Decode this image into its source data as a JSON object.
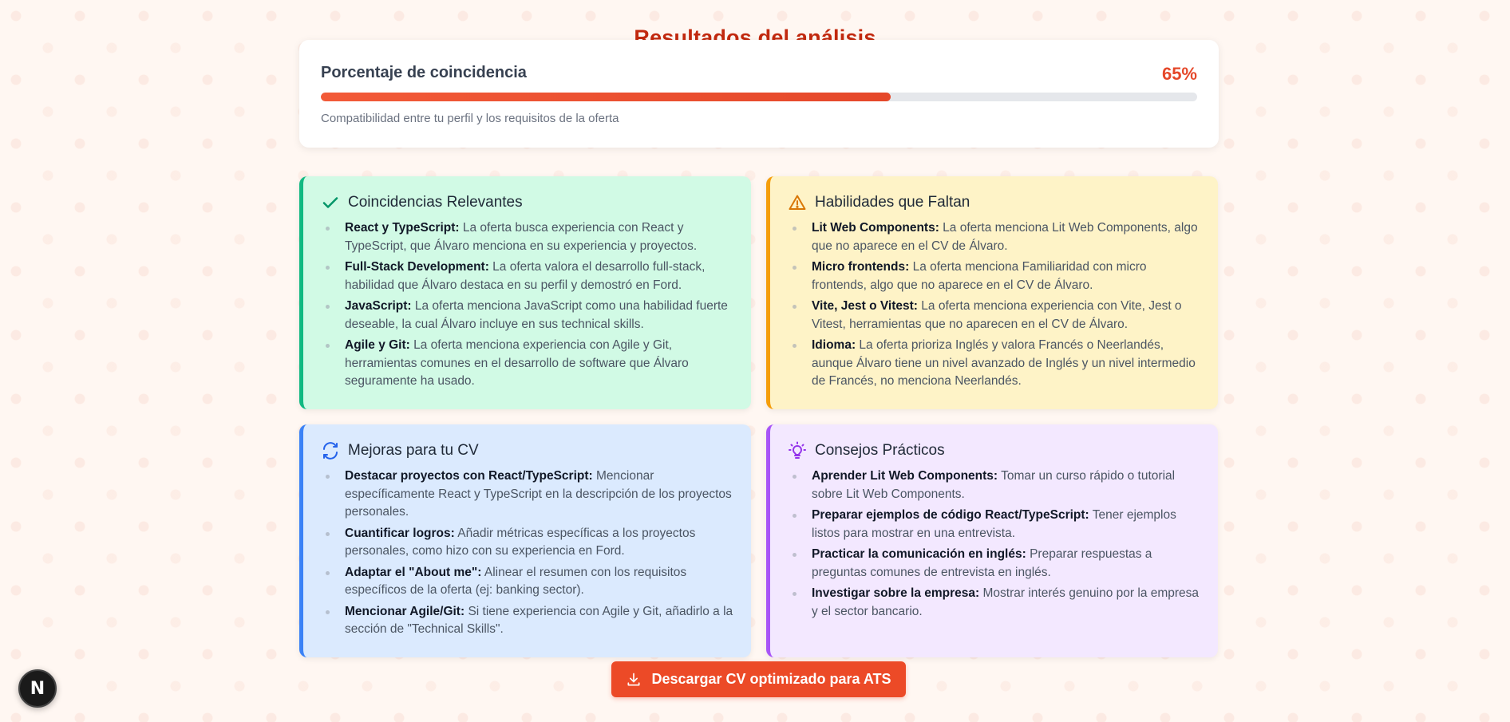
{
  "title": "Resultados del análisis",
  "match": {
    "label": "Porcentaje de coincidencia",
    "percent_text": "65%",
    "percent_value": 65,
    "subtitle": "Compatibilidad entre tu perfil y los requisitos de la oferta"
  },
  "cards": {
    "relevant": {
      "title": "Coincidencias Relevantes",
      "icon": "check-icon",
      "accent": "#10b981",
      "items": [
        {
          "term": "React y TypeScript:",
          "text": " La oferta busca experiencia con React y TypeScript, que Álvaro menciona en su experiencia y proyectos."
        },
        {
          "term": "Full-Stack Development:",
          "text": " La oferta valora el desarrollo full-stack, habilidad que Álvaro destaca en su perfil y demostró en Ford."
        },
        {
          "term": "JavaScript:",
          "text": " La oferta menciona JavaScript como una habilidad fuerte deseable, la cual Álvaro incluye en sus technical skills."
        },
        {
          "term": "Agile y Git:",
          "text": " La oferta menciona experiencia con Agile y Git, herramientas comunes en el desarrollo de software que Álvaro seguramente ha usado."
        }
      ]
    },
    "missing": {
      "title": "Habilidades que Faltan",
      "icon": "warning-icon",
      "accent": "#f59e0b",
      "items": [
        {
          "term": "Lit Web Components:",
          "text": " La oferta menciona Lit Web Components, algo que no aparece en el CV de Álvaro."
        },
        {
          "term": "Micro frontends:",
          "text": " La oferta menciona Familiaridad con micro frontends, algo que no aparece en el CV de Álvaro."
        },
        {
          "term": "Vite, Jest o Vitest:",
          "text": " La oferta menciona experiencia con Vite, Jest o Vitest, herramientas que no aparecen en el CV de Álvaro."
        },
        {
          "term": "Idioma:",
          "text": " La oferta prioriza Inglés y valora Francés o Neerlandés, aunque Álvaro tiene un nivel avanzado de Inglés y un nivel intermedio de Francés, no menciona Neerlandés."
        }
      ]
    },
    "improvements": {
      "title": "Mejoras para tu CV",
      "icon": "refresh-icon",
      "accent": "#3b82f6",
      "items": [
        {
          "term": "Destacar proyectos con React/TypeScript:",
          "text": " Mencionar específicamente React y TypeScript en la descripción de los proyectos personales."
        },
        {
          "term": "Cuantificar logros:",
          "text": " Añadir métricas específicas a los proyectos personales, como hizo con su experiencia en Ford."
        },
        {
          "term": "Adaptar el \"About me\":",
          "text": " Alinear el resumen con los requisitos específicos de la oferta (ej: banking sector)."
        },
        {
          "term": "Mencionar Agile/Git:",
          "text": " Si tiene experiencia con Agile y Git, añadirlo a la sección de \"Technical Skills\"."
        }
      ]
    },
    "tips": {
      "title": "Consejos Prácticos",
      "icon": "lightbulb-icon",
      "accent": "#a855f7",
      "items": [
        {
          "term": "Aprender Lit Web Components:",
          "text": " Tomar un curso rápido o tutorial sobre Lit Web Components."
        },
        {
          "term": "Preparar ejemplos de código React/TypeScript:",
          "text": " Tener ejemplos listos para mostrar en una entrevista."
        },
        {
          "term": "Practicar la comunicación en inglés:",
          "text": " Preparar respuestas a preguntas comunes de entrevista en inglés."
        },
        {
          "term": "Investigar sobre la empresa:",
          "text": " Mostrar interés genuino por la empresa y el sector bancario."
        }
      ]
    }
  },
  "download": {
    "label": "Descargar CV optimizado para ATS",
    "icon": "download-icon"
  },
  "badge": {
    "text": "N",
    "icon": "nextjs-logo-icon"
  },
  "colors": {
    "title": "#c2290f",
    "accent": "#ec4a27",
    "progress_track": "#e5e7eb"
  }
}
